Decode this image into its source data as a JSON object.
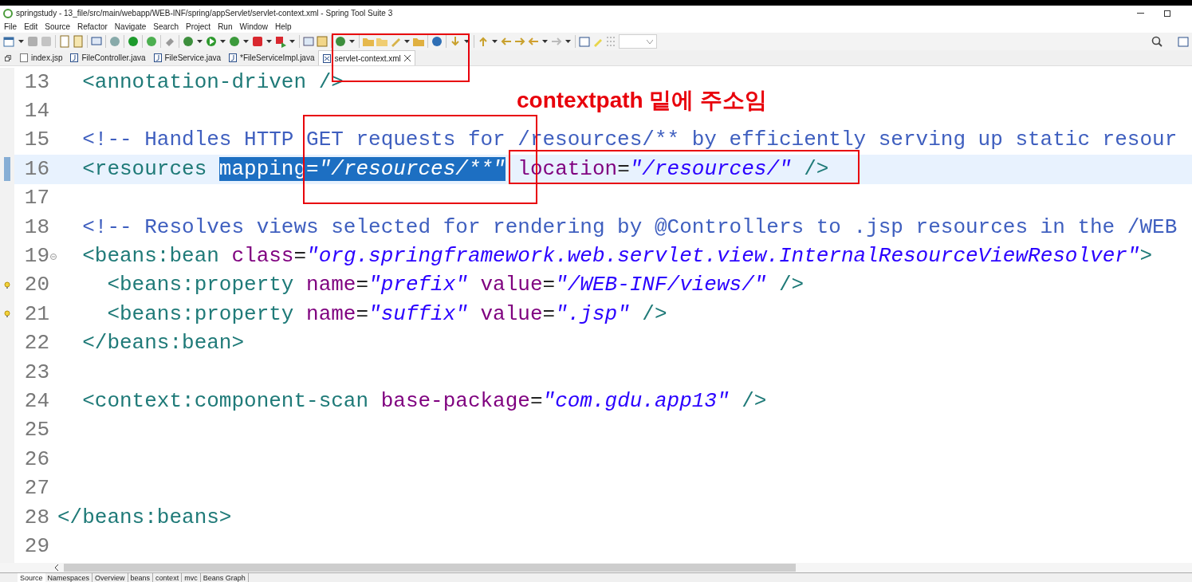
{
  "window": {
    "title": "springstudy - 13_file/src/main/webapp/WEB-INF/spring/appServlet/servlet-context.xml - Spring Tool Suite 3"
  },
  "menu": [
    "File",
    "Edit",
    "Source",
    "Refactor",
    "Navigate",
    "Search",
    "Project",
    "Run",
    "Window",
    "Help"
  ],
  "tabs": [
    {
      "label": "index.jsp",
      "kind": "jsp",
      "selected": false
    },
    {
      "label": "FileController.java",
      "kind": "java",
      "selected": false
    },
    {
      "label": "FileService.java",
      "kind": "java",
      "selected": false
    },
    {
      "label": "*FileServiceImpl.java",
      "kind": "java",
      "selected": false
    },
    {
      "label": "servlet-context.xml",
      "kind": "xml",
      "selected": true
    }
  ],
  "annotation": {
    "text": "contextpath 밑에 주소임"
  },
  "lines": [
    {
      "number": "13",
      "current": false,
      "tokens": [
        {
          "kind": "tag",
          "text": "  <annotation-driven"
        },
        {
          "kind": "tag",
          "text": " />"
        }
      ]
    },
    {
      "number": "14",
      "current": false
    },
    {
      "number": "15",
      "current": false,
      "tokens": [
        {
          "kind": "comment",
          "text": "  <!-- Handles HTTP GET requests for /resources/** by efficiently serving up static resour"
        }
      ]
    },
    {
      "number": "16",
      "current": true,
      "gutter_icon": {
        "kind": "change"
      },
      "tokens": [
        {
          "kind": "tag",
          "text": "  <resources "
        },
        {
          "kind": "attr",
          "text": "mapping",
          "selected": true
        },
        {
          "kind": "plain",
          "text": "=",
          "selected": true
        },
        {
          "kind": "value",
          "text": "\"/resources/**\"",
          "selected": true
        },
        {
          "kind": "attr",
          "text": " location"
        },
        {
          "kind": "plain",
          "text": "="
        },
        {
          "kind": "value",
          "text": "\"/resources/\""
        },
        {
          "kind": "tag",
          "text": " />"
        }
      ]
    },
    {
      "number": "17",
      "current": false
    },
    {
      "number": "18",
      "current": false,
      "tokens": [
        {
          "kind": "comment",
          "text": "  <!-- Resolves views selected for rendering by @Controllers to .jsp resources in the /WEB"
        }
      ]
    },
    {
      "number": "19",
      "current": false,
      "gutter_icon": {
        "kind": "fold"
      },
      "tokens": [
        {
          "kind": "tag",
          "text": "  <beans:bean"
        },
        {
          "kind": "attr",
          "text": " class"
        },
        {
          "kind": "plain",
          "text": "="
        },
        {
          "kind": "value",
          "text": "\"org.springframework.web.servlet.view.InternalResourceViewResolver\""
        },
        {
          "kind": "tag",
          "text": ">"
        }
      ]
    },
    {
      "number": "20",
      "current": false,
      "gutter_icon": {
        "kind": "warning"
      },
      "tokens": [
        {
          "kind": "tag",
          "text": "    <beans:property"
        },
        {
          "kind": "attr",
          "text": " name"
        },
        {
          "kind": "plain",
          "text": "="
        },
        {
          "kind": "value",
          "text": "\"prefix\""
        },
        {
          "kind": "attr",
          "text": " value"
        },
        {
          "kind": "plain",
          "text": "="
        },
        {
          "kind": "value",
          "text": "\"/WEB-INF/views/\""
        },
        {
          "kind": "tag",
          "text": " />"
        }
      ]
    },
    {
      "number": "21",
      "current": false,
      "gutter_icon": {
        "kind": "warning"
      },
      "tokens": [
        {
          "kind": "tag",
          "text": "    <beans:property"
        },
        {
          "kind": "attr",
          "text": " name"
        },
        {
          "kind": "plain",
          "text": "="
        },
        {
          "kind": "value",
          "text": "\"suffix\""
        },
        {
          "kind": "attr",
          "text": " value"
        },
        {
          "kind": "plain",
          "text": "="
        },
        {
          "kind": "value",
          "text": "\".jsp\""
        },
        {
          "kind": "tag",
          "text": " />"
        }
      ]
    },
    {
      "number": "22",
      "current": false,
      "tokens": [
        {
          "kind": "tag",
          "text": "  </beans:bean>"
        }
      ]
    },
    {
      "number": "23",
      "current": false
    },
    {
      "number": "24",
      "current": false,
      "tokens": [
        {
          "kind": "tag",
          "text": "  <context:component-scan"
        },
        {
          "kind": "attr",
          "text": " base-package"
        },
        {
          "kind": "plain",
          "text": "="
        },
        {
          "kind": "value",
          "text": "\"com.gdu.app13\""
        },
        {
          "kind": "tag",
          "text": " />"
        }
      ]
    },
    {
      "number": "25",
      "current": false
    },
    {
      "number": "26",
      "current": false
    },
    {
      "number": "27",
      "current": false
    },
    {
      "number": "28",
      "current": false,
      "tokens": [
        {
          "kind": "tag",
          "text": "</beans:beans>"
        }
      ]
    },
    {
      "number": "29",
      "current": false
    }
  ],
  "bottom_tabs": [
    {
      "label": "Source",
      "selected": true
    },
    {
      "label": "Namespaces",
      "selected": false
    },
    {
      "label": "Overview",
      "selected": false
    },
    {
      "label": "beans",
      "selected": false
    },
    {
      "label": "context",
      "selected": false
    },
    {
      "label": "mvc",
      "selected": false
    },
    {
      "label": "Beans Graph",
      "selected": false
    }
  ]
}
